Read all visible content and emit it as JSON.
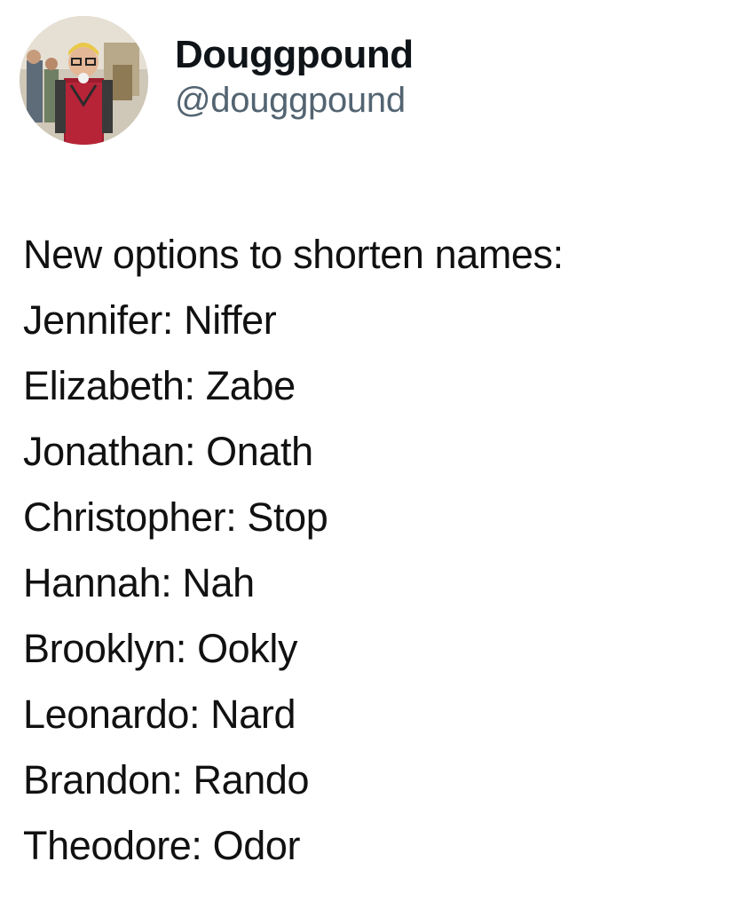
{
  "author": {
    "display_name": "Douggpound",
    "handle": "@douggpound",
    "avatar_icon": "profile-photo"
  },
  "tweet": {
    "intro": "New options to shorten names:",
    "lines": [
      "Jennifer: Niffer",
      "Elizabeth: Zabe",
      "Jonathan: Onath",
      "Christopher: Stop",
      "Hannah: Nah",
      "Brooklyn: Ookly",
      "Leonardo: Nard",
      "Brandon: Rando",
      "Theodore: Odor"
    ]
  },
  "colors": {
    "background": "#ffffff",
    "text": "#111111",
    "handle": "#536471"
  }
}
